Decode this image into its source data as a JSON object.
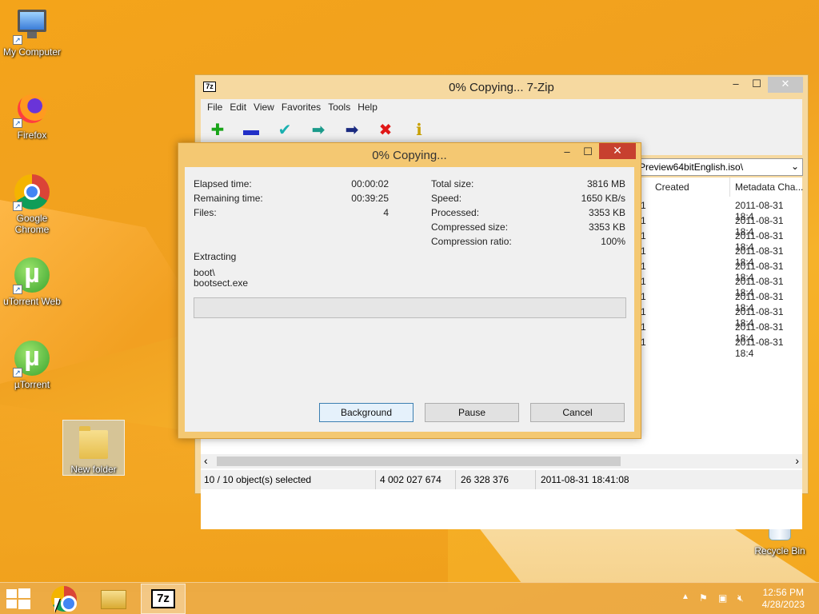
{
  "desktop": {
    "icons": [
      {
        "label": "My Computer",
        "icon": "computer-icon"
      },
      {
        "label": "Firefox",
        "icon": "firefox-icon"
      },
      {
        "label": "Google Chrome",
        "icon": "chrome-icon"
      },
      {
        "label": "uTorrent Web",
        "icon": "utorrent-web-icon"
      },
      {
        "label": "µTorrent",
        "icon": "utorrent-icon"
      },
      {
        "label": "New folder",
        "icon": "folder-icon"
      },
      {
        "label": "Recycle Bin",
        "icon": "recycle-bin-icon"
      }
    ]
  },
  "main_window": {
    "app_icon_text": "7z",
    "title": "0% Copying... 7-Zip",
    "minimize": "–",
    "maximize": "☐",
    "close": "✕",
    "menu": [
      "File",
      "Edit",
      "View",
      "Favorites",
      "Tools",
      "Help"
    ],
    "toolbar": [
      "add-icon",
      "extract-icon",
      "test-icon",
      "copy-icon",
      "move-icon",
      "delete-icon",
      "info-icon"
    ],
    "path": "Preview64bitEnglish.iso\\",
    "path_chevron": "⌄",
    "columns": [
      "Created",
      "Metadata Cha..."
    ],
    "rows": [
      {
        "c1": "1",
        "date": "2011-08-31 18:4"
      },
      {
        "c1": "1",
        "date": "2011-08-31 18:4"
      },
      {
        "c1": "1",
        "date": "2011-08-31 18:4"
      },
      {
        "c1": "1",
        "date": "2011-08-31 18:4"
      },
      {
        "c1": "1",
        "date": "2011-08-31 18:4"
      },
      {
        "c1": "1",
        "date": "2011-08-31 18:4"
      },
      {
        "c1": "1",
        "date": "2011-08-31 18:4"
      },
      {
        "c1": "1",
        "date": "2011-08-31 18:4"
      },
      {
        "c1": "1",
        "date": "2011-08-31 18:4"
      },
      {
        "c1": "1",
        "date": "2011-08-31 18:4"
      }
    ],
    "scroll_left": "‹",
    "scroll_right": "›",
    "status": {
      "selected": "10 / 10 object(s) selected",
      "size": "4 002 027 674",
      "packed": "26 328 376",
      "modified": "2011-08-31 18:41:08"
    }
  },
  "dialog": {
    "title": "0% Copying...",
    "minimize": "–",
    "maximize": "☐",
    "close": "✕",
    "left_stats": [
      {
        "label": "Elapsed time:",
        "value": "00:00:02"
      },
      {
        "label": "Remaining time:",
        "value": "00:39:25"
      },
      {
        "label": "Files:",
        "value": "4"
      }
    ],
    "right_stats": [
      {
        "label": "Total size:",
        "value": "3816 MB"
      },
      {
        "label": "Speed:",
        "value": "1650 KB/s"
      },
      {
        "label": "Processed:",
        "value": "3353 KB"
      },
      {
        "label": "Compressed size:",
        "value": "3353 KB"
      },
      {
        "label": "Compression ratio:",
        "value": "100%"
      }
    ],
    "operation": "Extracting",
    "current_dir": "boot\\",
    "current_file": "bootsect.exe",
    "progress_percent": 0,
    "buttons": {
      "background": "Background",
      "pause": "Pause",
      "cancel": "Cancel"
    }
  },
  "taskbar": {
    "apps": [
      "chrome-icon",
      "file-explorer-icon",
      "7zip-icon"
    ],
    "tray": {
      "chevron": "▲"
    },
    "time": "12:56 PM",
    "date": "4/28/2023"
  }
}
